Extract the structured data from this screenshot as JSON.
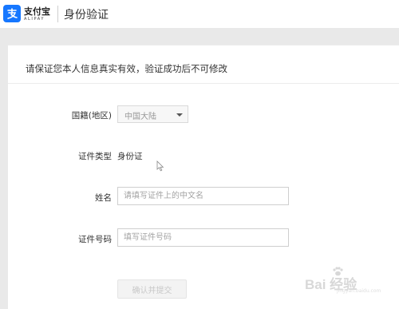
{
  "header": {
    "logo_text_cn": "支付宝",
    "logo_text_en": "ALIPAY",
    "page_title": "身份验证",
    "brand_color": "#1677ff"
  },
  "form": {
    "notice": "请保证您本人信息真实有效，验证成功后不可修改",
    "nationality": {
      "label": "国籍(地区)",
      "value": "中国大陆"
    },
    "id_type": {
      "label": "证件类型",
      "value": "身份证"
    },
    "name": {
      "label": "姓名",
      "value": "",
      "placeholder": "请填写证件上的中文名"
    },
    "id_number": {
      "label": "证件号码",
      "value": "",
      "placeholder": "填写证件号码"
    },
    "submit_label": "确认并提交"
  },
  "watermark": {
    "text": "Bai 经验",
    "url": "jingyan.baidu.com"
  }
}
